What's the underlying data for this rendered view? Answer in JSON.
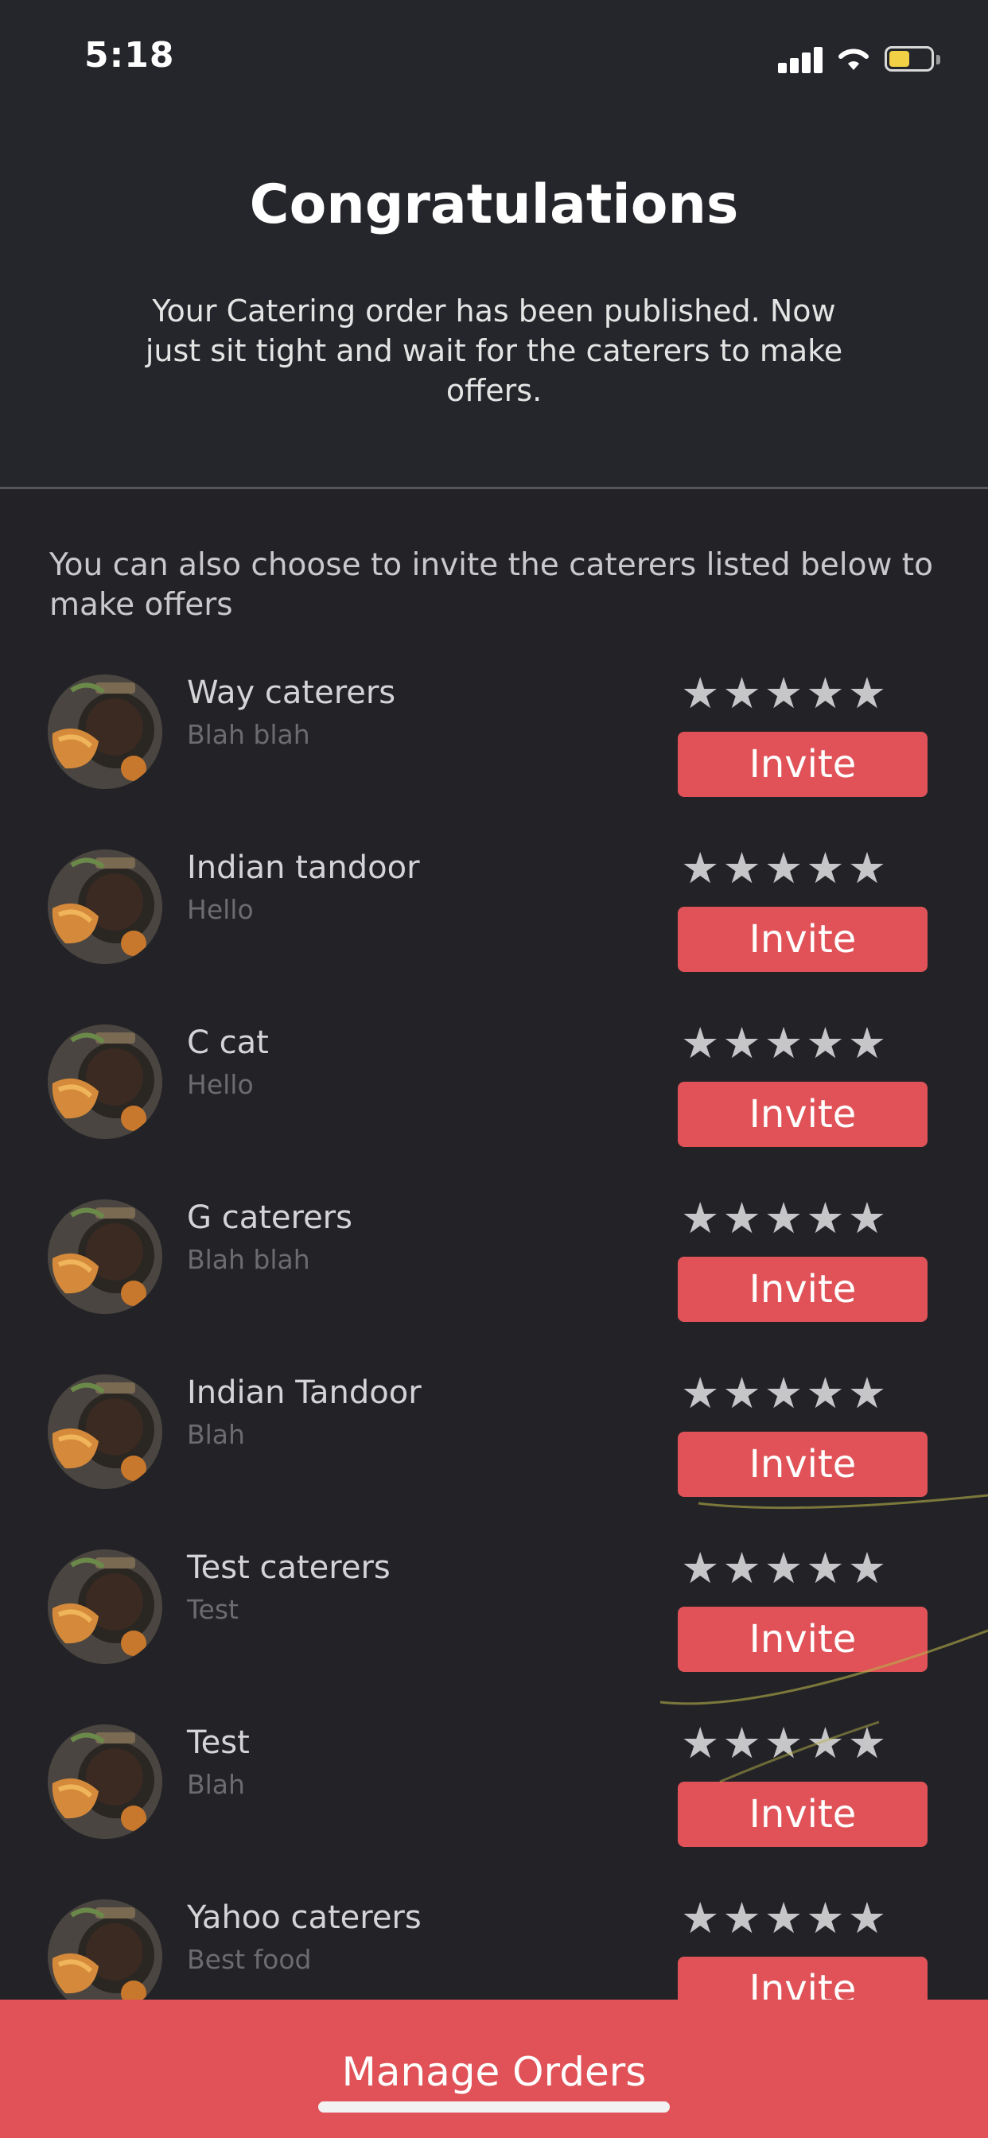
{
  "status_bar": {
    "time": "5:18"
  },
  "header": {
    "title": "Congratulations",
    "message": "Your Catering order has been published. Now just sit tight and wait for the caterers to make offers."
  },
  "intro_text": "You can also choose to invite the caterers listed below to make offers",
  "caterers": [
    {
      "name": "Way caterers",
      "description": "Blah blah",
      "rating": 5,
      "rating_max": 5,
      "invite_label": "Invite"
    },
    {
      "name": "Indian tandoor",
      "description": "Hello",
      "rating": 5,
      "rating_max": 5,
      "invite_label": "Invite"
    },
    {
      "name": "C cat",
      "description": "Hello",
      "rating": 5,
      "rating_max": 5,
      "invite_label": "Invite"
    },
    {
      "name": "G caterers",
      "description": "Blah blah",
      "rating": 5,
      "rating_max": 5,
      "invite_label": "Invite"
    },
    {
      "name": "Indian Tandoor",
      "description": "Blah",
      "rating": 5,
      "rating_max": 5,
      "invite_label": "Invite"
    },
    {
      "name": "Test caterers",
      "description": "Test",
      "rating": 5,
      "rating_max": 5,
      "invite_label": "Invite"
    },
    {
      "name": "Test",
      "description": "Blah",
      "rating": 5,
      "rating_max": 5,
      "invite_label": "Invite"
    },
    {
      "name": "Yahoo caterers",
      "description": "Best food",
      "rating": 5,
      "rating_max": 5,
      "invite_label": "Invite"
    }
  ],
  "footer": {
    "manage_orders_label": "Manage Orders"
  },
  "icons": {
    "signal": "cellular-signal-icon",
    "wifi": "wifi-icon",
    "battery": "battery-icon",
    "star": "star-icon",
    "avatar": "caterer-food-avatar"
  },
  "colors": {
    "background": "#232327",
    "accent": "#e05257",
    "star": "#c6c6c9",
    "battery_level": "#f2d046"
  },
  "battery_level": 0.5
}
